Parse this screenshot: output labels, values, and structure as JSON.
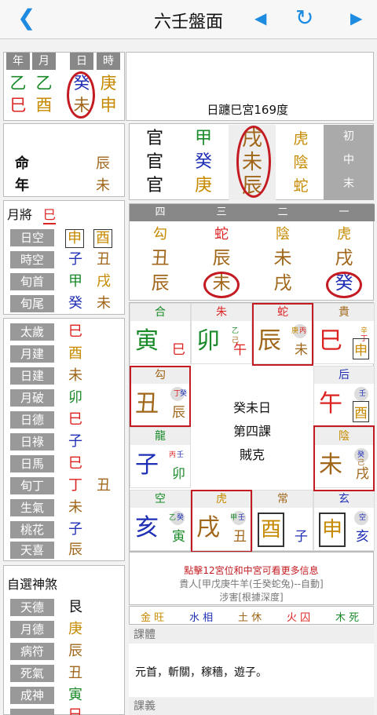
{
  "header": {
    "title": "六壬盤面",
    "back_icon": "chevron-left-icon",
    "prev_icon": "triangle-left-icon",
    "refresh_icon": "refresh-icon",
    "next_icon": "triangle-right-icon",
    "accent": "#1d8be0"
  },
  "date": {
    "headers": [
      "年",
      "月",
      "日",
      "時"
    ],
    "stems": [
      "乙",
      "乙",
      "癸",
      "庚"
    ],
    "branches": [
      "巳",
      "酉",
      "未",
      "申"
    ]
  },
  "river": {
    "text": "日躔巳宮169度"
  },
  "ming": {
    "ming_label": "命",
    "ming_value": "辰",
    "nian_label": "年",
    "nian_value": "未"
  },
  "yuejiang": {
    "label": "月將",
    "value": "巳"
  },
  "kong": [
    {
      "label": "日空",
      "a": "申",
      "b": "酉"
    },
    {
      "label": "時空",
      "a": "子",
      "b": "丑"
    },
    {
      "label": "旬首",
      "a": "甲",
      "b": "戌"
    },
    {
      "label": "旬尾",
      "a": "癸",
      "b": "未"
    }
  ],
  "shensha": [
    {
      "label": "太歲",
      "value": "巳"
    },
    {
      "label": "月建",
      "value": "酉"
    },
    {
      "label": "日建",
      "value": "未"
    },
    {
      "label": "月破",
      "value": "卯"
    },
    {
      "label": "日德",
      "value": "巳"
    },
    {
      "label": "日祿",
      "value": "子"
    },
    {
      "label": "日馬",
      "value": "巳"
    },
    {
      "label": "旬丁",
      "value": "丁",
      "extra": "丑"
    },
    {
      "label": "生氣",
      "value": "未"
    },
    {
      "label": "桃花",
      "value": "子"
    },
    {
      "label": "天喜",
      "value": "辰"
    }
  ],
  "zixuan": {
    "title": "自選神煞",
    "items": [
      {
        "label": "天德",
        "value": "艮"
      },
      {
        "label": "月德",
        "value": "庚"
      },
      {
        "label": "病符",
        "value": "辰"
      },
      {
        "label": "死氣",
        "value": "丑"
      },
      {
        "label": "成神",
        "value": "寅"
      },
      {
        "label": "",
        "value": "巳"
      }
    ]
  },
  "sanchuan": {
    "liuqin": [
      "官",
      "官",
      "官"
    ],
    "dungan": [
      "甲",
      "癸",
      "庚"
    ],
    "zhi": [
      "戌",
      "未",
      "辰"
    ],
    "jiang": [
      "虎",
      "陰",
      "蛇"
    ],
    "labels": [
      "初",
      "中",
      "末"
    ]
  },
  "sike": {
    "headers": [
      "四",
      "三",
      "二",
      "一"
    ],
    "jiang": [
      "勾",
      "蛇",
      "陰",
      "虎"
    ],
    "upper": [
      "丑",
      "辰",
      "未",
      "戌"
    ],
    "lower": [
      "辰",
      "未",
      "戌",
      "癸"
    ]
  },
  "palaces": [
    {
      "god": "合",
      "zhi": "寅",
      "s1": "",
      "s2": "",
      "earth": "巳"
    },
    {
      "god": "朱",
      "zhi": "卯",
      "s1": "乙",
      "s2": "己",
      "earth": "午"
    },
    {
      "god": "蛇",
      "zhi": "辰",
      "s1": "庚",
      "s2": "丙",
      "earth": "未"
    },
    {
      "god": "貴",
      "zhi": "巳",
      "s1": "辛",
      "s2": "丁",
      "earth": "申"
    },
    {
      "god": "勾",
      "zhi": "丑",
      "s1": "丁",
      "s2": "癸",
      "earth": "辰"
    },
    {
      "god": "后",
      "zhi": "午",
      "s1": "壬",
      "s2": "",
      "earth": "酉"
    },
    {
      "god": "龍",
      "zhi": "子",
      "s1": "丙",
      "s2": "壬",
      "earth": "卯"
    },
    {
      "god": "陰",
      "zhi": "未",
      "s1": "癸",
      "s2": "己",
      "earth": "戌"
    },
    {
      "god": "空",
      "zhi": "亥",
      "s1": "乙",
      "s2": "癸",
      "earth": "寅"
    },
    {
      "god": "虎",
      "zhi": "戌",
      "s1": "甲",
      "s2": "壬",
      "earth": "丑"
    },
    {
      "god": "常",
      "zhi": "酉",
      "s1": "",
      "s2": "",
      "earth": "子"
    },
    {
      "god": "玄",
      "zhi": "申",
      "s1": "空",
      "s2": "",
      "earth": "亥"
    }
  ],
  "center": {
    "line1": "癸未日",
    "line2": "第四課",
    "line3": "賊克"
  },
  "info": {
    "line1": "點擊12宮位和中宮可看更多信息",
    "line2": "貴人[甲戊庚牛羊(壬癸蛇兔)--自動]",
    "line3": "涉害[根據深度]"
  },
  "wuxing": [
    {
      "label": "金 旺"
    },
    {
      "label": "水 相"
    },
    {
      "label": "土 休"
    },
    {
      "label": "火 囚"
    },
    {
      "label": "木 死"
    }
  ],
  "keti": {
    "title": "課體",
    "text": "元首，斬關，稼穡，遊子。"
  },
  "keyi": {
    "title": "課義"
  }
}
